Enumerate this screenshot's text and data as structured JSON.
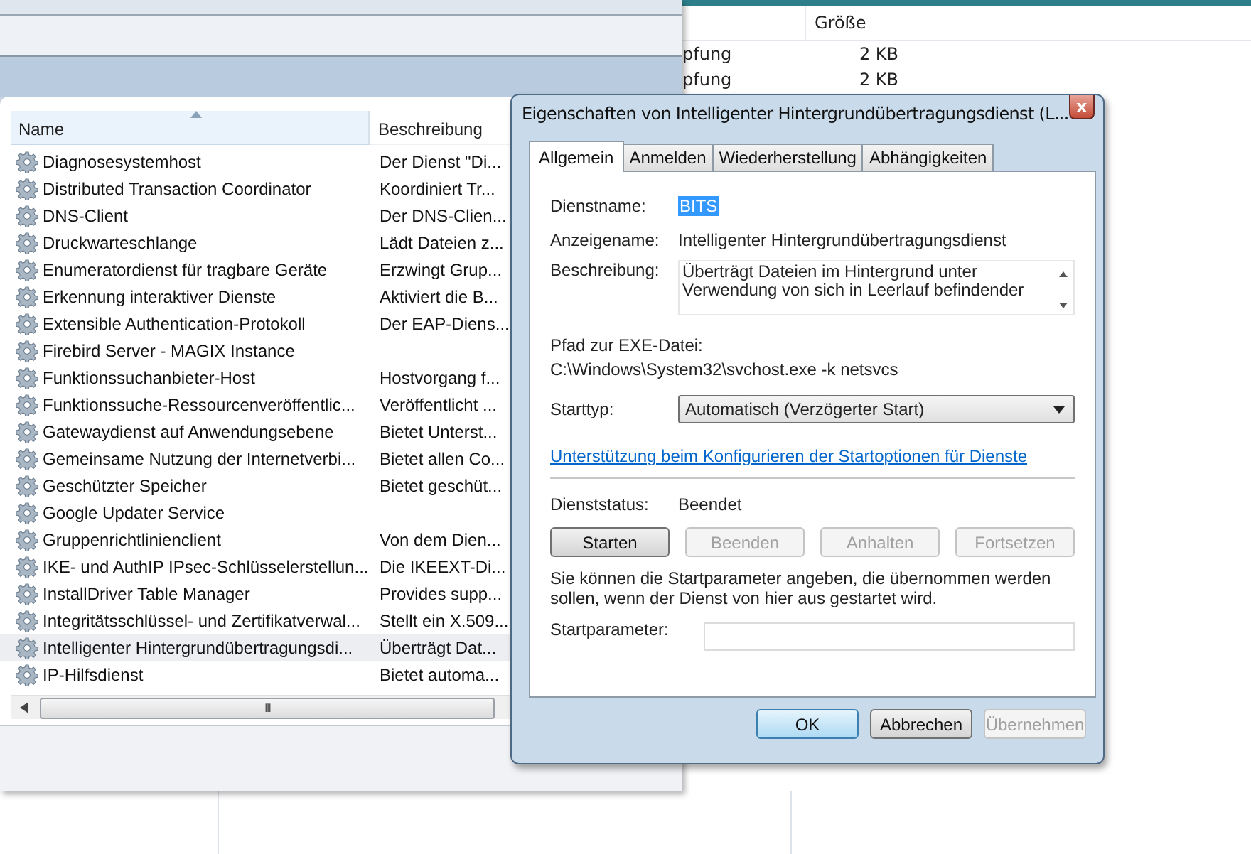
{
  "back_window": {
    "columns": [
      {
        "label": "Größe"
      }
    ],
    "rows": [
      {
        "column_1": "pfung",
        "size": "2 KB"
      },
      {
        "column_1": "pfung",
        "size": "2 KB"
      }
    ]
  },
  "services": {
    "columns": [
      {
        "label": "Name"
      },
      {
        "label": "Beschreibung"
      }
    ],
    "rows": [
      {
        "name": "Diagnosesystemhost",
        "description": "Der Dienst \"Di...",
        "selected": false
      },
      {
        "name": "Distributed Transaction Coordinator",
        "description": "Koordiniert Tr...",
        "selected": false
      },
      {
        "name": "DNS-Client",
        "description": "Der DNS-Clien...",
        "selected": false
      },
      {
        "name": "Druckwarteschlange",
        "description": "Lädt Dateien z...",
        "selected": false
      },
      {
        "name": "Enumeratordienst für tragbare Geräte",
        "description": "Erzwingt Grup...",
        "selected": false
      },
      {
        "name": "Erkennung interaktiver Dienste",
        "description": "Aktiviert die B...",
        "selected": false
      },
      {
        "name": "Extensible Authentication-Protokoll",
        "description": "Der EAP-Diens...",
        "selected": false
      },
      {
        "name": "Firebird Server - MAGIX Instance",
        "description": "",
        "selected": false
      },
      {
        "name": "Funktionssuchanbieter-Host",
        "description": "Hostvorgang f...",
        "selected": false
      },
      {
        "name": "Funktionssuche-Ressourcenveröffentlic...",
        "description": "Veröffentlicht ...",
        "selected": false
      },
      {
        "name": "Gatewaydienst auf Anwendungsebene",
        "description": "Bietet Unterst...",
        "selected": false
      },
      {
        "name": "Gemeinsame Nutzung der Internetverbi...",
        "description": "Bietet allen Co...",
        "selected": false
      },
      {
        "name": "Geschützter Speicher",
        "description": "Bietet geschüt...",
        "selected": false
      },
      {
        "name": "Google Updater Service",
        "description": "",
        "selected": false
      },
      {
        "name": "Gruppenrichtlinienclient",
        "description": "Von dem Dien...",
        "selected": false
      },
      {
        "name": "IKE- und AuthIP IPsec-Schlüsselerstellun...",
        "description": "Die IKEEXT-Di...",
        "selected": false
      },
      {
        "name": "InstallDriver Table Manager",
        "description": "Provides supp...",
        "selected": false
      },
      {
        "name": "Integritätsschlüssel- und Zertifikatverwal...",
        "description": "Stellt ein X.509...",
        "selected": false
      },
      {
        "name": "Intelligenter Hintergrundübertragungsdi...",
        "description": "Überträgt Dat...",
        "selected": true
      },
      {
        "name": "IP-Hilfsdienst",
        "description": "Bietet automa...",
        "selected": false
      }
    ],
    "scrollbar_grip": "III"
  },
  "dialog": {
    "title": "Eigenschaften von Intelligenter Hintergrundübertragungsdienst (L...",
    "close": "x",
    "tabs": [
      {
        "label": "Allgemein",
        "selected": true
      },
      {
        "label": "Anmelden",
        "selected": false
      },
      {
        "label": "Wiederherstellung",
        "selected": false
      },
      {
        "label": "Abhängigkeiten",
        "selected": false
      }
    ],
    "service_name_label": "Dienstname:",
    "service_name": "BITS",
    "display_name_label": "Anzeigename:",
    "display_name": "Intelligenter Hintergrundübertragungsdienst",
    "description_label": "Beschreibung:",
    "description": "Überträgt Dateien im Hintergrund unter Verwendung von sich in Leerlauf befindender",
    "path_label": "Pfad zur EXE-Datei:",
    "path": "C:\\Windows\\System32\\svchost.exe -k netsvcs",
    "startup_label": "Starttyp:",
    "startup_type": "Automatisch (Verzögerter Start)",
    "help_link": "Unterstützung beim Konfigurieren der Startoptionen für Dienste",
    "status_label": "Dienststatus:",
    "status": "Beendet",
    "service_buttons": [
      {
        "label": "Starten",
        "disabled": false
      },
      {
        "label": "Beenden",
        "disabled": true
      },
      {
        "label": "Anhalten",
        "disabled": true
      },
      {
        "label": "Fortsetzen",
        "disabled": true
      }
    ],
    "hint": "Sie können die Startparameter angeben, die übernommen werden sollen, wenn der Dienst von hier aus gestartet wird.",
    "param_label": "Startparameter:",
    "buttons": [
      {
        "label": "OK",
        "disabled": false,
        "default": true
      },
      {
        "label": "Abbrechen",
        "disabled": false,
        "default": false
      },
      {
        "label": "Übernehmen",
        "disabled": true,
        "default": false
      }
    ]
  }
}
